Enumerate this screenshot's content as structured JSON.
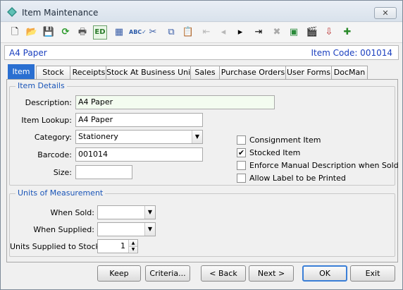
{
  "window": {
    "title": "Item Maintenance",
    "close_glyph": "✕"
  },
  "toolbar": {
    "icons": [
      "new-icon",
      "open-icon",
      "save-icon",
      "refresh-icon",
      "print-icon",
      "edit-icon",
      "calculator-icon",
      "spellcheck-icon",
      "cut-icon",
      "copy-icon",
      "paste-icon",
      "first-icon",
      "previous-icon",
      "next-icon",
      "last-icon",
      "delete-icon",
      "find-icon",
      "clapboard-icon",
      "export-icon",
      "add-note-icon"
    ]
  },
  "header": {
    "item_name": "A4 Paper",
    "item_code_label": "Item Code: 001014"
  },
  "tabs": [
    "Item",
    "Stock",
    "Receipts",
    "Stock At Business Units",
    "Sales",
    "Purchase Orders",
    "User Forms",
    "DocMan"
  ],
  "item_details": {
    "title": "Item Details",
    "description_label": "Description:",
    "description_value": "A4 Paper",
    "lookup_label": "Item Lookup:",
    "lookup_value": "A4 Paper",
    "category_label": "Category:",
    "category_value": "Stationery",
    "barcode_label": "Barcode:",
    "barcode_value": "001014",
    "size_label": "Size:",
    "size_value": ""
  },
  "checkboxes": [
    {
      "label": "Consignment Item",
      "checked": false
    },
    {
      "label": "Stocked Item",
      "checked": true
    },
    {
      "label": "Enforce Manual Description when Sold",
      "checked": false
    },
    {
      "label": "Allow Label to be Printed",
      "checked": false
    }
  ],
  "units": {
    "title": "Units of Measurement",
    "when_sold_label": "When Sold:",
    "when_sold_value": "",
    "when_supplied_label": "When Supplied:",
    "when_supplied_value": "",
    "supplied_to_stock_label": "Units Supplied to Stock:",
    "supplied_to_stock_value": "1"
  },
  "buttons": {
    "keep": "Keep",
    "criteria": "Criteria...",
    "back": "< Back",
    "next": "Next >",
    "ok": "OK",
    "exit": "Exit"
  }
}
